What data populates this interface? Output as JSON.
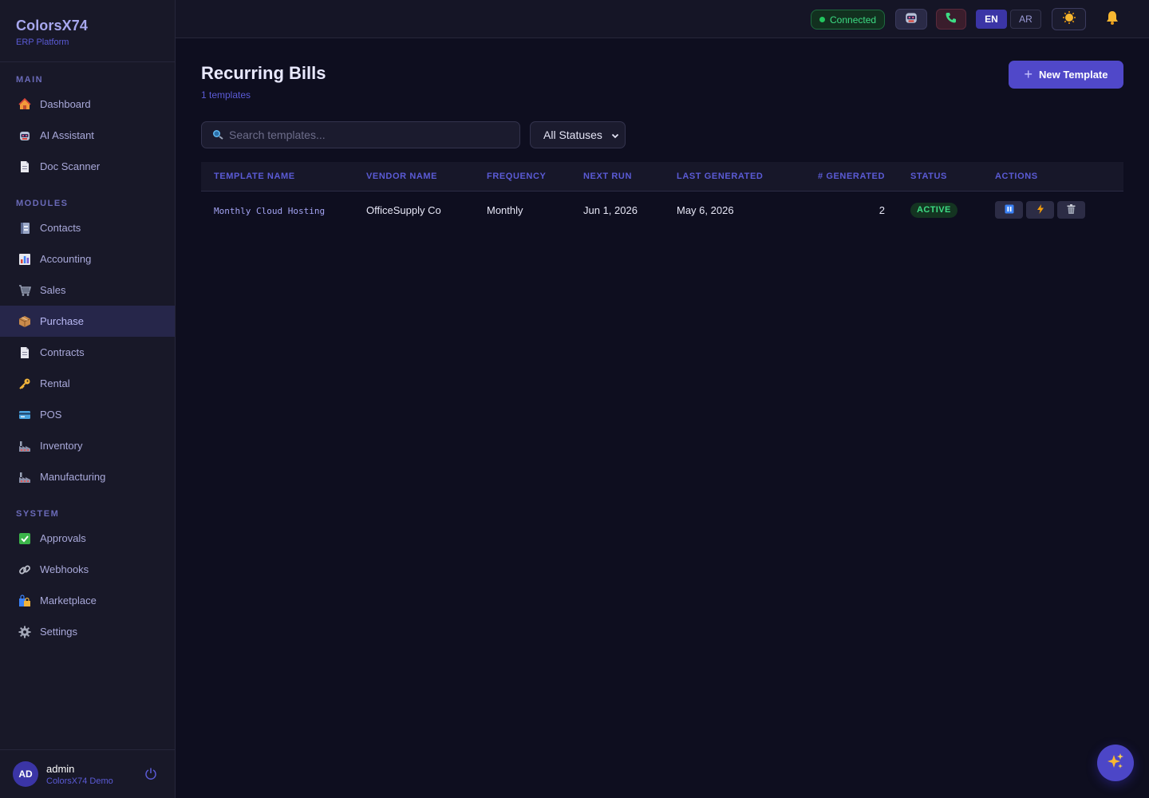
{
  "brand": {
    "name": "ColorsX74",
    "subtitle": "ERP Platform"
  },
  "sidebar": {
    "sections": [
      {
        "label": "MAIN",
        "items": [
          {
            "label": "Dashboard",
            "icon": "house-icon"
          },
          {
            "label": "AI Assistant",
            "icon": "robot-icon"
          },
          {
            "label": "Doc Scanner",
            "icon": "document-icon"
          }
        ]
      },
      {
        "label": "MODULES",
        "items": [
          {
            "label": "Contacts",
            "icon": "address-book-icon"
          },
          {
            "label": "Accounting",
            "icon": "bar-chart-icon"
          },
          {
            "label": "Sales",
            "icon": "cart-icon"
          },
          {
            "label": "Purchase",
            "icon": "package-icon",
            "active": true
          },
          {
            "label": "Contracts",
            "icon": "document-icon"
          },
          {
            "label": "Rental",
            "icon": "key-icon"
          },
          {
            "label": "POS",
            "icon": "credit-card-icon"
          },
          {
            "label": "Inventory",
            "icon": "factory-icon"
          },
          {
            "label": "Manufacturing",
            "icon": "factory-icon"
          }
        ]
      },
      {
        "label": "SYSTEM",
        "items": [
          {
            "label": "Approvals",
            "icon": "checkmark-icon"
          },
          {
            "label": "Webhooks",
            "icon": "link-icon"
          },
          {
            "label": "Marketplace",
            "icon": "shopping-bags-icon"
          },
          {
            "label": "Settings",
            "icon": "gear-icon"
          }
        ]
      }
    ]
  },
  "user": {
    "initials": "AD",
    "name": "admin",
    "org": "ColorsX74 Demo"
  },
  "topbar": {
    "connection_status": "Connected",
    "languages": [
      "EN",
      "AR"
    ],
    "active_language": "EN"
  },
  "page": {
    "title": "Recurring Bills",
    "count_text": "1 templates",
    "new_button": "New Template"
  },
  "filters": {
    "search_placeholder": "Search templates...",
    "status_selected": "All Statuses"
  },
  "table": {
    "columns": [
      "Template Name",
      "Vendor Name",
      "Frequency",
      "Next Run",
      "Last Generated",
      "# Generated",
      "Status",
      "Actions"
    ],
    "rows": [
      {
        "template_name": "Monthly Cloud Hosting",
        "vendor_name": "OfficeSupply Co",
        "frequency": "Monthly",
        "next_run": "Jun 1, 2026",
        "last_generated": "May 6, 2026",
        "generated_count": "2",
        "status": "ACTIVE",
        "actions": [
          "pause-icon",
          "bolt-icon",
          "trash-icon"
        ]
      }
    ]
  },
  "colors": {
    "background": "#0e0e1f",
    "sidebar": "#181828",
    "accent": "#5048c9",
    "link": "#5b5bd6",
    "status_active": "#3ddc84"
  }
}
